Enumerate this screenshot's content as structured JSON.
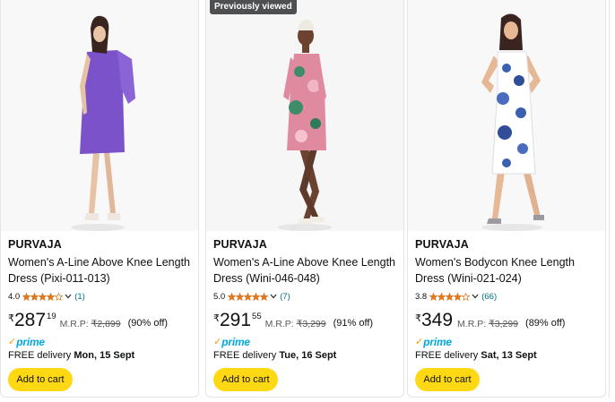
{
  "products": [
    {
      "badge": "",
      "brand": "PURVAJA",
      "title": "Women's A-Line Above Knee Length Dress (Pixi-011-013)",
      "rating": "4.0",
      "stars": 4,
      "reviews": "(1)",
      "currency": "₹",
      "price_whole": "287",
      "price_fraction": "19",
      "mrp_label": "M.R.P:",
      "mrp_value": "₹2,899",
      "discount": "(90% off)",
      "prime": "prime",
      "delivery_label": "FREE delivery",
      "delivery_date": "Mon, 15 Sept",
      "cart_label": "Add to cart",
      "dress_color": "#7b52c9",
      "bg_color": "#f8f8f8"
    },
    {
      "badge": "Previously viewed",
      "brand": "PURVAJA",
      "title": "Women's A-Line Above Knee Length Dress (Wini-046-048)",
      "rating": "5.0",
      "stars": 5,
      "reviews": "(7)",
      "currency": "₹",
      "price_whole": "291",
      "price_fraction": "55",
      "mrp_label": "M.R.P:",
      "mrp_value": "₹3,299",
      "discount": "(91% off)",
      "prime": "prime",
      "delivery_label": "FREE delivery",
      "delivery_date": "Tue, 16 Sept",
      "cart_label": "Add to cart",
      "dress_color": "#e08aa0",
      "bg_color": "#f6f6f6"
    },
    {
      "badge": "",
      "brand": "PURVAJA",
      "title": "Women's Bodycon Knee Length Dress (Wini-021-024)",
      "rating": "3.8",
      "stars": 4,
      "reviews": "(66)",
      "currency": "₹",
      "price_whole": "349",
      "price_fraction": "",
      "mrp_label": "M.R.P:",
      "mrp_value": "₹3,299",
      "discount": "(89% off)",
      "prime": "prime",
      "delivery_label": "FREE delivery",
      "delivery_date": "Sat, 13 Sept",
      "cart_label": "Add to cart",
      "dress_color": "#3d5fb0",
      "bg_color": "#f8f8f8"
    }
  ],
  "colors": {
    "star": "#de7921",
    "link": "#007185",
    "cart": "#ffd814",
    "prime_check": "#ff9900",
    "prime_text": "#00a8e1"
  }
}
